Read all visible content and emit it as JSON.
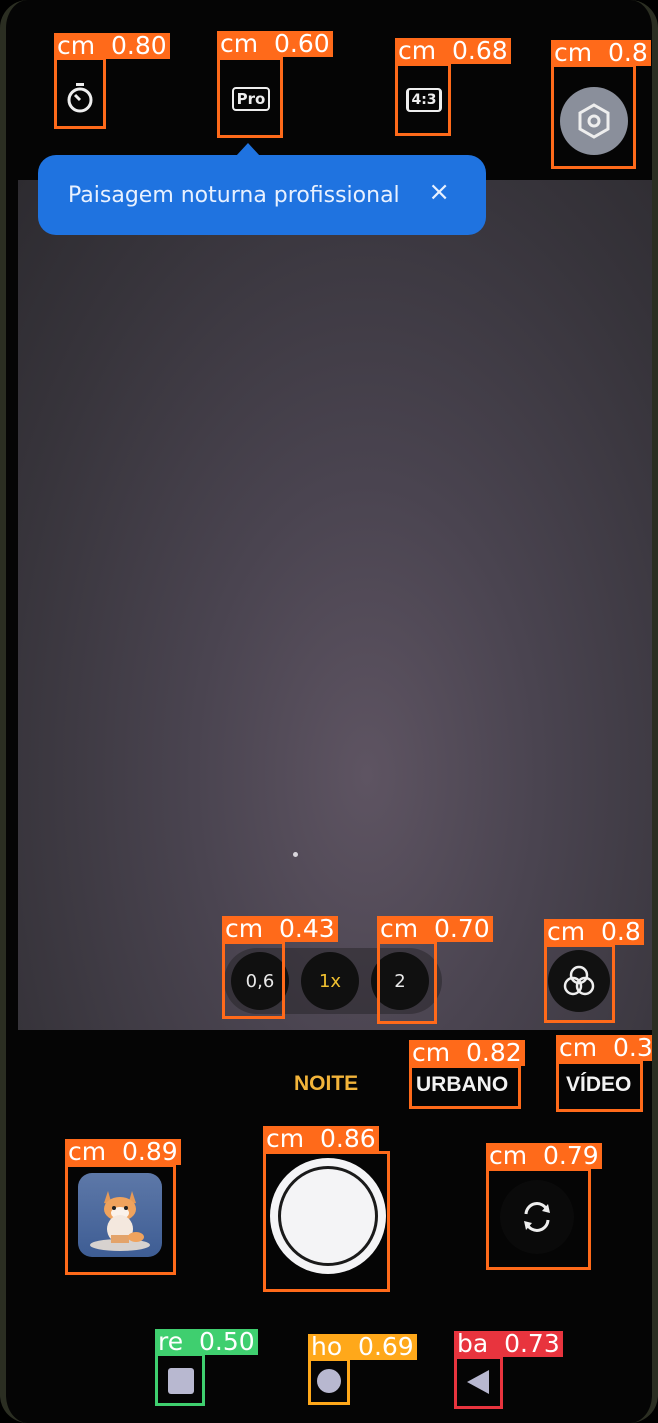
{
  "tooltip": {
    "text": "Paisagem noturna profissional",
    "close": "×"
  },
  "top_icons": {
    "timer": "timer-icon",
    "pro": "Pro",
    "ratio": "4:3",
    "settings": "settings-hexagon-icon"
  },
  "zoom": {
    "wide": "0,6",
    "normal": "1x",
    "tele": "2"
  },
  "filter_icon": "filter-circles-icon",
  "modes": {
    "night": "NOITE",
    "urban": "URBANO",
    "video": "VÍDEO",
    "active": "NOITE"
  },
  "controls": {
    "gallery": "gallery-thumbnail",
    "shutter": "shutter-button",
    "switch": "switch-camera-icon"
  },
  "nav": {
    "recent": "square-icon",
    "home": "circle-icon",
    "back": "triangle-back-icon"
  },
  "detections": {
    "timer": "cm  0.80",
    "pro": "cm  0.60",
    "ratio": "cm  0.68",
    "settings": "cm  0.8",
    "wide": "cm  0.43",
    "tele": "cm  0.70",
    "filter": "cm  0.8",
    "urban": "cm  0.82",
    "video": "cm  0.3",
    "gallery": "cm  0.89",
    "shutter": "cm  0.86",
    "switch": "cm  0.79",
    "recent": "re  0.50",
    "home": "ho  0.69",
    "back": "ba  0.73"
  },
  "colors": {
    "detection_orange": "#ff6a1a",
    "detection_green": "#3fcf6f",
    "detection_yellow": "#ffa81a",
    "detection_red": "#e8343e",
    "tooltip_blue": "#1f73e0",
    "active_mode": "#f2b43a",
    "active_zoom": "#f0c030"
  }
}
